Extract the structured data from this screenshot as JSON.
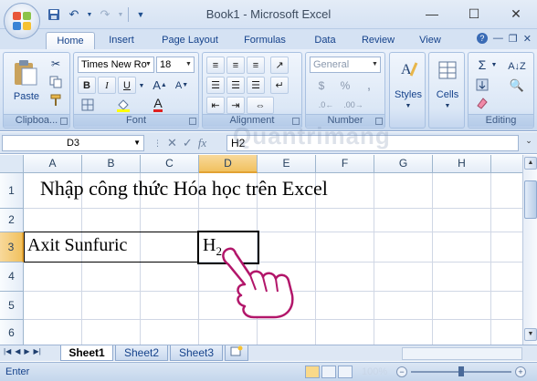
{
  "window": {
    "title": "Book1 - Microsoft Excel"
  },
  "qat": [
    "save-icon",
    "undo-icon",
    "redo-icon",
    "customize-icon"
  ],
  "tabs": [
    "Home",
    "Insert",
    "Page Layout",
    "Formulas",
    "Data",
    "Review",
    "View"
  ],
  "ribbon": {
    "clipboard": {
      "paste": "Paste",
      "label": "Clipboa..."
    },
    "font": {
      "name": "Times New Ro",
      "size": "18",
      "label": "Font",
      "bold": "B",
      "italic": "I",
      "underline": "U"
    },
    "alignment": {
      "label": "Alignment"
    },
    "number": {
      "format": "General",
      "label": "Number",
      "dollar": "$",
      "percent": "%"
    },
    "styles": {
      "label": "Styles"
    },
    "cells": {
      "label": "Cells"
    },
    "editing": {
      "label": "Editing"
    }
  },
  "formula_bar": {
    "name_box": "D3",
    "fx": "fx",
    "value": "H2"
  },
  "watermark": "Quantrimang",
  "columns": [
    "A",
    "B",
    "C",
    "D",
    "E",
    "F",
    "G",
    "H"
  ],
  "rows": [
    "1",
    "2",
    "3",
    "4",
    "5",
    "6"
  ],
  "cells": {
    "A1": "Nhập công thức Hóa học trên Excel",
    "A3": "Axit Sunfuric",
    "D3_base": "H",
    "D3_sub": "2"
  },
  "selected": {
    "column": "D",
    "row": "3"
  },
  "sheets": [
    "Sheet1",
    "Sheet2",
    "Sheet3"
  ],
  "active_sheet": "Sheet1",
  "status": {
    "mode": "Enter",
    "zoom": "100%"
  }
}
